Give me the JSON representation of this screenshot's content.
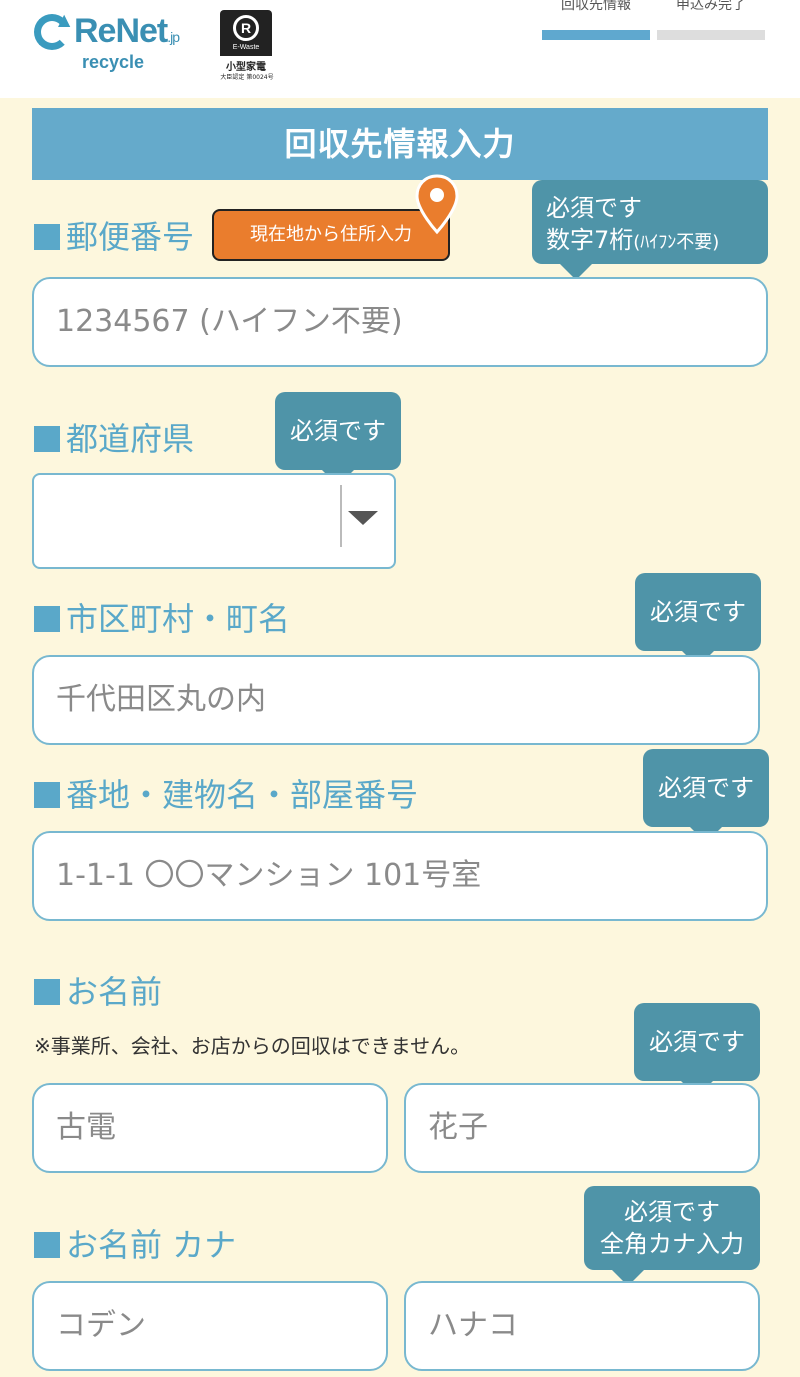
{
  "header": {
    "brand": "ReNet",
    "brand_suffix": ".jp",
    "brand_sub": "recycle",
    "logo_icon": "renet-refresh-icon",
    "cert": {
      "icon": "e-waste-r-icon",
      "badge_letter": "R",
      "badge_label": "E-Waste",
      "title": "小型家電",
      "subtitle": "大臣認定 第0024号"
    },
    "steps": [
      {
        "label": "回収先情報",
        "active": true,
        "color": "#5fa8cf"
      },
      {
        "label": "申込み完了",
        "active": false,
        "color": "#dddddd"
      }
    ]
  },
  "form": {
    "section_title": "回収先情報入力",
    "postal": {
      "label": "郵便番号",
      "geo_button": "現在地から住所入力",
      "required_line1": "必須です",
      "required_line2_main": "数字7桁",
      "required_line2_small": "(ﾊｲﾌﾝ不要)",
      "placeholder": "1234567 (ハイフン不要)"
    },
    "prefecture": {
      "label": "都道府県",
      "required": "必須です",
      "selected": ""
    },
    "city": {
      "label": "市区町村・町名",
      "required": "必須です",
      "placeholder": "千代田区丸の内"
    },
    "address": {
      "label": "番地・建物名・部屋番号",
      "required": "必須です",
      "placeholder": "1-1-1 〇〇マンション 101号室"
    },
    "name": {
      "label": "お名前",
      "note": "※事業所、会社、お店からの回収はできません。",
      "required": "必須です",
      "last_placeholder": "古電",
      "first_placeholder": "花子"
    },
    "kana": {
      "label": "お名前 カナ",
      "required_line1": "必須です",
      "required_line2": "全角カナ入力",
      "last_placeholder": "コデン",
      "first_placeholder": "ハナコ"
    }
  },
  "colors": {
    "accent": "#65aacb",
    "label": "#5aa8c9",
    "bubble": "#4f94a8",
    "geo_button": "#ea7d2d",
    "background": "#fdf7dd"
  }
}
